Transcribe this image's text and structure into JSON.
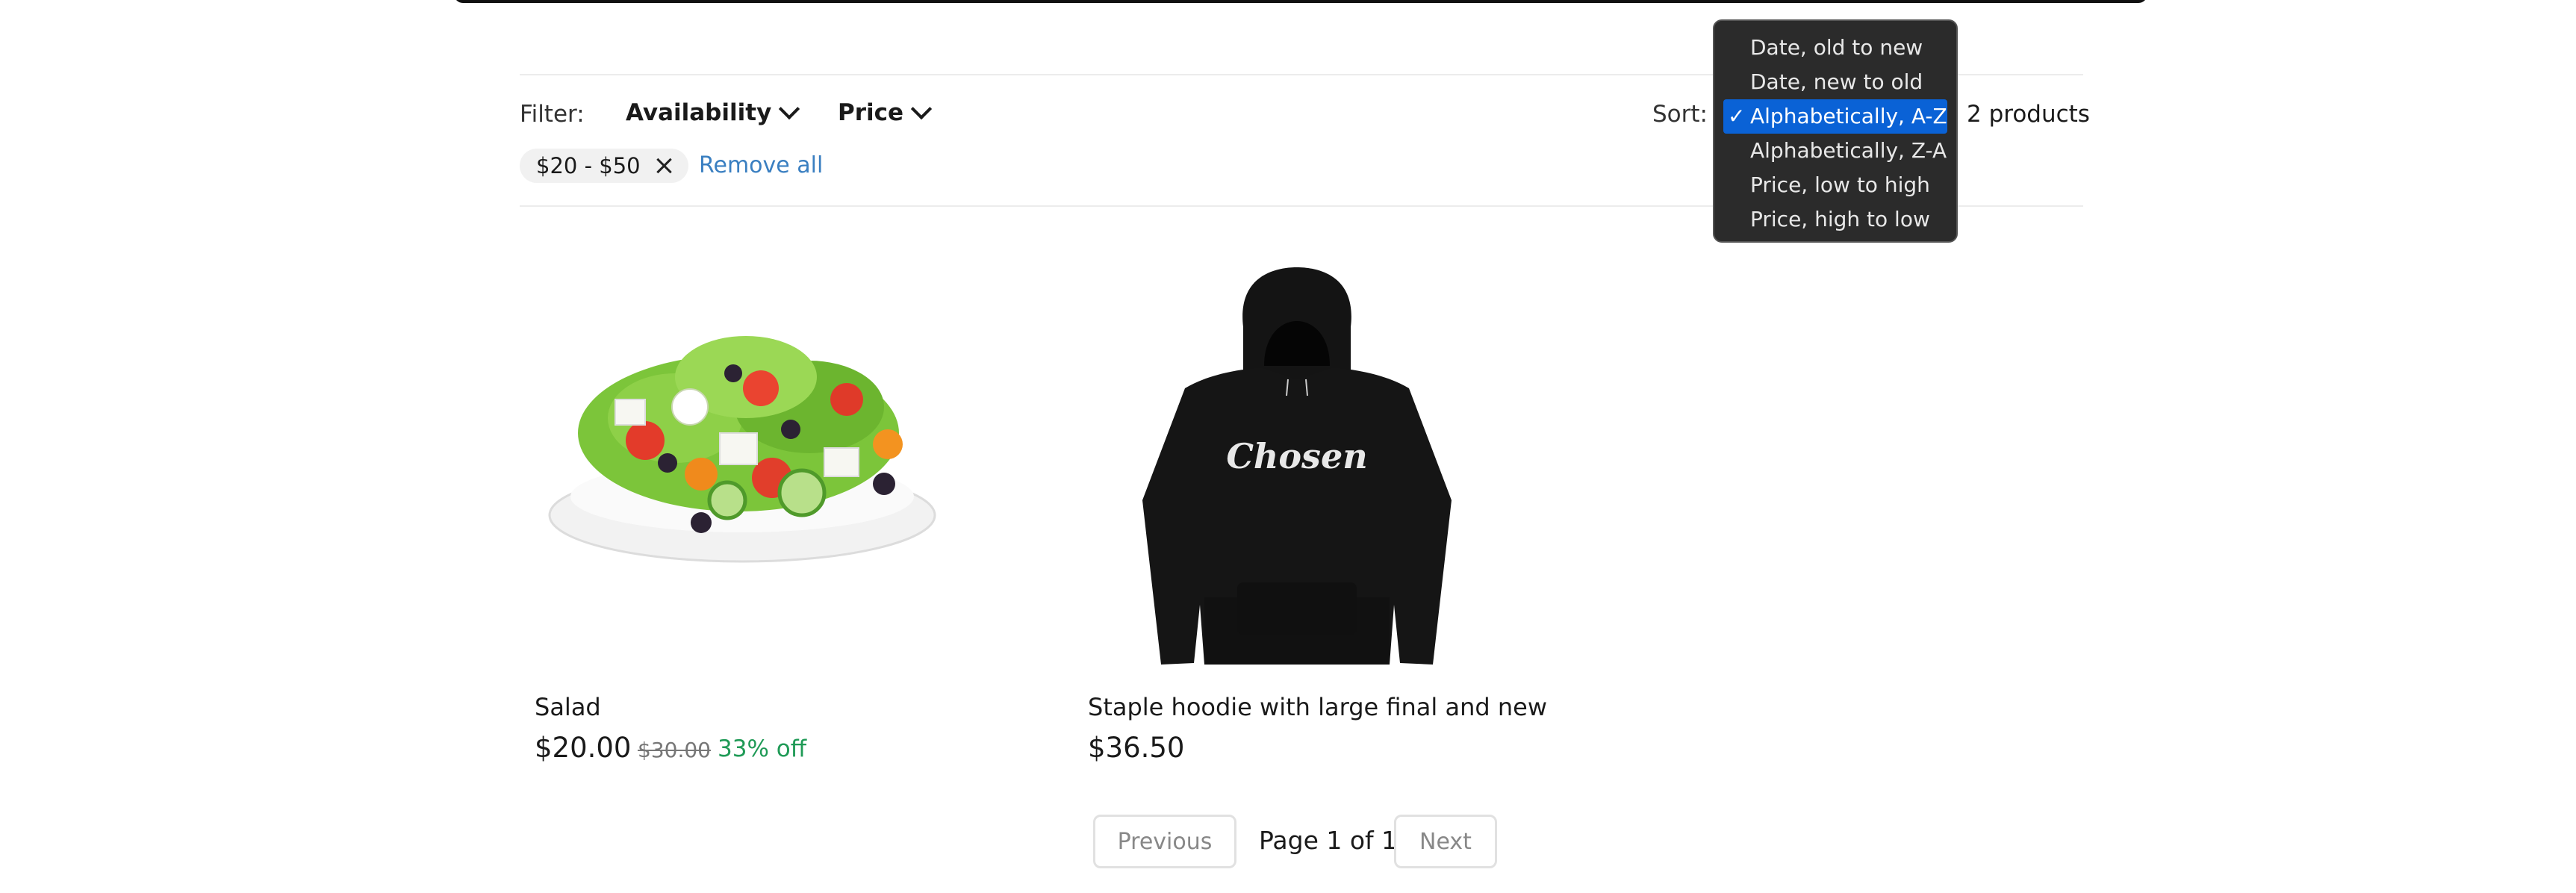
{
  "filters": {
    "label": "Filter:",
    "availability_label": "Availability",
    "price_label": "Price",
    "active_chip": "$20 - $50",
    "remove_all": "Remove all"
  },
  "sort": {
    "label": "Sort:",
    "options": [
      "Date, old to new",
      "Date, new to old",
      "Alphabetically, A-Z",
      "Alphabetically, Z-A",
      "Price, low to high",
      "Price, high to low"
    ],
    "selected": "Alphabetically, A-Z",
    "check_mark": "✓"
  },
  "product_count": "2 products",
  "products": [
    {
      "title": "Salad",
      "price": "$20.00",
      "compare_price": "$30.00",
      "discount": "33% off",
      "image": "salad-image"
    },
    {
      "title": "Staple hoodie with large final and new",
      "price": "$36.50",
      "image": "hoodie-image",
      "hoodie_print": "Chosen"
    }
  ],
  "pagination": {
    "previous": "Previous",
    "page_text": "Page 1 of 1",
    "next": "Next"
  },
  "colors": {
    "accent_link": "#3a7fc1",
    "discount_green": "#1f9a56",
    "selected_option": "#0a62d6",
    "menu_bg": "#2b2b2b"
  }
}
